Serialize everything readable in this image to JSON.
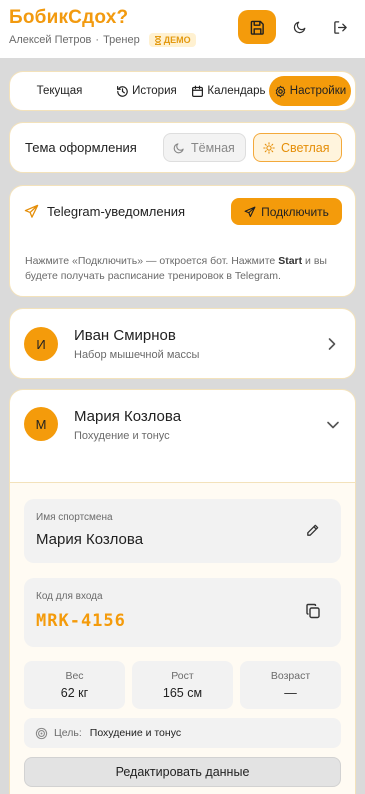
{
  "header": {
    "title": "БобикСдох?",
    "user": "Алексей Петров",
    "separator": "·",
    "role": "Тренер",
    "demo_badge": "ДЕМО"
  },
  "tabs": [
    {
      "label": "Текущая",
      "active": false
    },
    {
      "label": "История",
      "active": false
    },
    {
      "label": "Календарь",
      "active": false
    },
    {
      "label": "Настройки",
      "active": true
    }
  ],
  "theme": {
    "label": "Тема оформления",
    "dark_label": "Тёмная",
    "light_label": "Светлая",
    "selected": "light"
  },
  "telegram": {
    "title": "Telegram-уведомления",
    "button_label": "Подключить",
    "desc_before": "Нажмите «Подключить» — откроется бот. Нажмите ",
    "desc_bold": "Start",
    "desc_after": " и вы будете получать расписание тренировок в Telegram."
  },
  "clients": [
    {
      "initial": "И",
      "name": "Иван Смирнов",
      "goal": "Набор мышечной массы",
      "expanded": false
    },
    {
      "initial": "М",
      "name": "Мария Козлова",
      "goal": "Похудение и тонус",
      "expanded": true
    }
  ],
  "details": {
    "name_label": "Имя спортсмена",
    "name_value": "Мария Козлова",
    "code_label": "Код для входа",
    "code_value": "MRK-4156",
    "stats": [
      {
        "label": "Вес",
        "value": "62 кг"
      },
      {
        "label": "Рост",
        "value": "165 см"
      },
      {
        "label": "Возраст",
        "value": "—"
      }
    ],
    "goal_label": "Цель:",
    "goal_value": "Похудение и тонус",
    "edit_button": "Редактировать данные"
  },
  "colors": {
    "accent": "#f49b0b",
    "background": "#dadada",
    "card": "#ffffff"
  }
}
